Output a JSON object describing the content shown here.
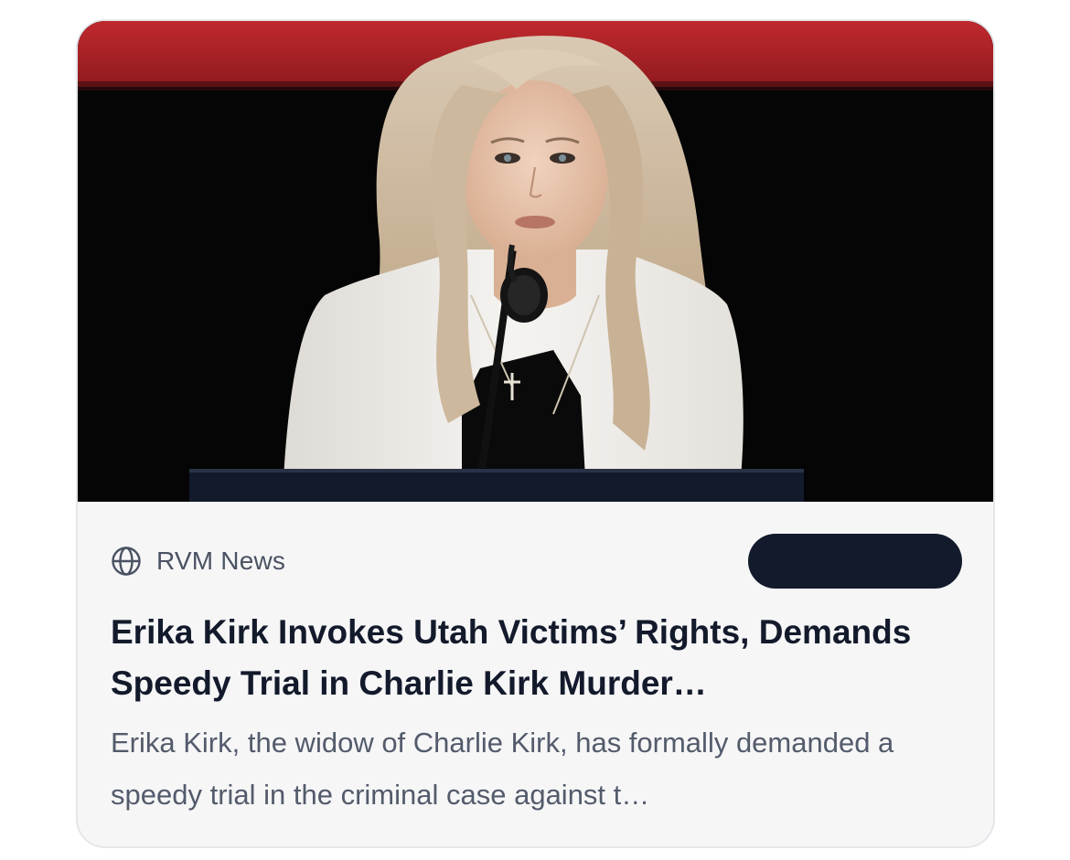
{
  "article": {
    "image_alt": "Woman with long blonde hair in a white blazer speaking at a podium microphone against a dark stage background",
    "source": {
      "name": "RVM News",
      "icon": "globe-icon"
    },
    "action_button_label": "",
    "headline": "Erika Kirk Invokes Utah Victims’ Rights, Demands Speedy Trial in Charlie Kirk Murder…",
    "summary": "Erika Kirk, the widow of Charlie Kirk, has formally demanded a speedy trial in the criminal case against t…"
  },
  "colors": {
    "card_background": "#f6f6f7",
    "card_border": "#e4e6ea",
    "headline": "#131a2b",
    "source_text": "#4a5263",
    "summary_text": "#535b6b",
    "button_background": "#131a2b",
    "stage_red": "#b8282c"
  }
}
